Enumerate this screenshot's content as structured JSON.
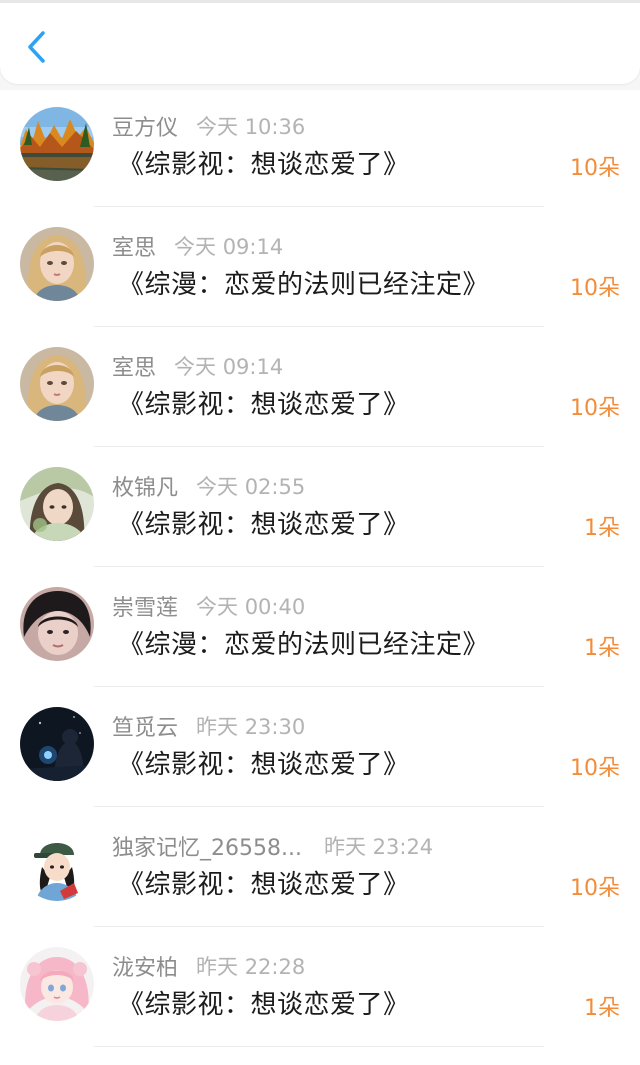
{
  "header": {
    "back_icon": "chevron-left-icon",
    "accent_color": "#2aa3f4"
  },
  "colors": {
    "flower_count": "#f28c38",
    "name": "#8d8d8d",
    "time": "#b3b3b3",
    "title": "#1c1c1c"
  },
  "records": [
    {
      "name": "豆方仪",
      "time": "今天 10:36",
      "book": "《综影视：想谈恋爱了》",
      "flowers": "10朵",
      "avatar": "autumn-lake-avatar"
    },
    {
      "name": "室思",
      "time": "今天 09:14",
      "book": "《综漫：恋爱的法则已经注定》",
      "flowers": "10朵",
      "avatar": "illustrated-girl-avatar"
    },
    {
      "name": "室思",
      "time": "今天 09:14",
      "book": "《综影视：想谈恋爱了》",
      "flowers": "10朵",
      "avatar": "illustrated-girl-avatar"
    },
    {
      "name": "枚锦凡",
      "time": "今天 02:55",
      "book": "《综影视：想谈恋爱了》",
      "flowers": "1朵",
      "avatar": "photo-girl-avatar"
    },
    {
      "name": "崇雪莲",
      "time": "今天 00:40",
      "book": "《综漫：恋爱的法则已经注定》",
      "flowers": "1朵",
      "avatar": "dark-hair-portrait-avatar"
    },
    {
      "name": "笪觅云",
      "time": "昨天 23:30",
      "book": "《综影视：想谈恋爱了》",
      "flowers": "10朵",
      "avatar": "night-scene-avatar"
    },
    {
      "name": "独家记忆_26558...",
      "time": "昨天 23:24",
      "book": "《综影视：想谈恋爱了》",
      "flowers": "10朵",
      "avatar": "cartoon-girl-cap-avatar"
    },
    {
      "name": "泷安柏",
      "time": "昨天 22:28",
      "book": "《综影视：想谈恋爱了》",
      "flowers": "1朵",
      "avatar": "pink-anime-girl-avatar"
    }
  ]
}
